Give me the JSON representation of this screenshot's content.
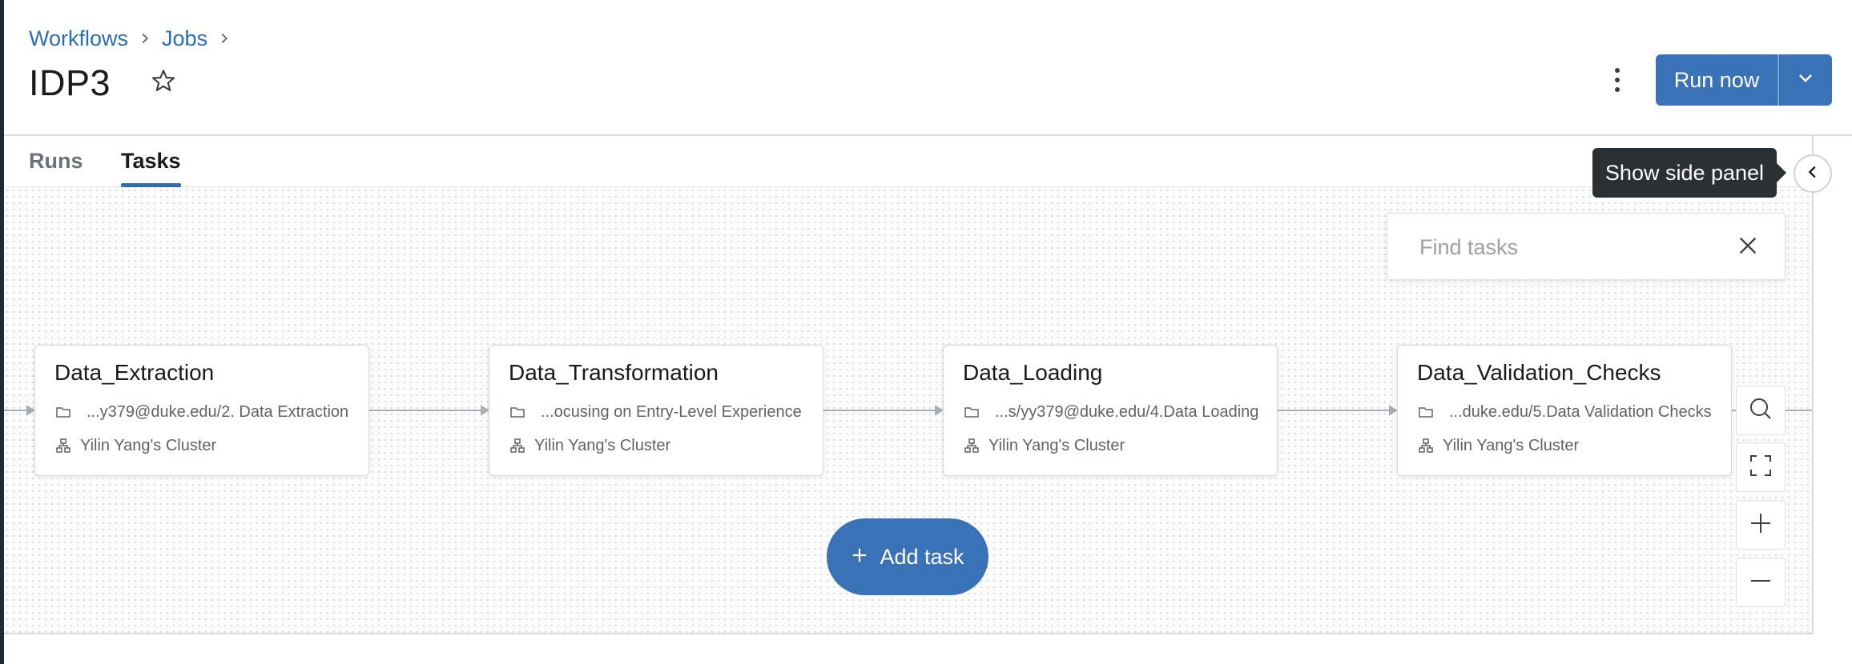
{
  "breadcrumb": {
    "items": [
      "Workflows",
      "Jobs"
    ]
  },
  "job": {
    "title": "IDP3"
  },
  "actions": {
    "run_now_label": "Run now"
  },
  "tabs": [
    {
      "label": "Runs",
      "active": false
    },
    {
      "label": "Tasks",
      "active": true
    }
  ],
  "tooltip": {
    "text": "Show side panel"
  },
  "search": {
    "placeholder": "Find tasks",
    "value": ""
  },
  "tasks": [
    {
      "name": "Data_Extraction",
      "path": "...y379@duke.edu/2. Data Extraction",
      "cluster": "Yilin Yang's Cluster"
    },
    {
      "name": "Data_Transformation",
      "path": "...ocusing on Entry-Level Experience",
      "cluster": "Yilin Yang's Cluster"
    },
    {
      "name": "Data_Loading",
      "path": "...s/yy379@duke.edu/4.Data Loading",
      "cluster": "Yilin Yang's Cluster"
    },
    {
      "name": "Data_Validation_Checks",
      "path": "...duke.edu/5.Data Validation Checks",
      "cluster": "Yilin Yang's Cluster"
    }
  ],
  "add_task": {
    "label": "Add task"
  },
  "icons": {
    "breadcrumb_separator": "chevron-right-icon",
    "favorite": "star-icon",
    "more": "kebab-menu-icon",
    "dropdown": "chevron-down-icon",
    "side_panel": "chevron-left-icon",
    "clear_search": "close-icon",
    "task_path": "folder-icon",
    "task_cluster": "cluster-icon",
    "add": "plus-icon",
    "find": "search-icon",
    "fit_view": "fit-view-icon",
    "zoom_in": "zoom-in-icon",
    "zoom_out": "zoom-out-icon"
  },
  "colors": {
    "accent": "#3a72b8",
    "link": "#2a6db5",
    "tooltip_bg": "#2b3035"
  }
}
